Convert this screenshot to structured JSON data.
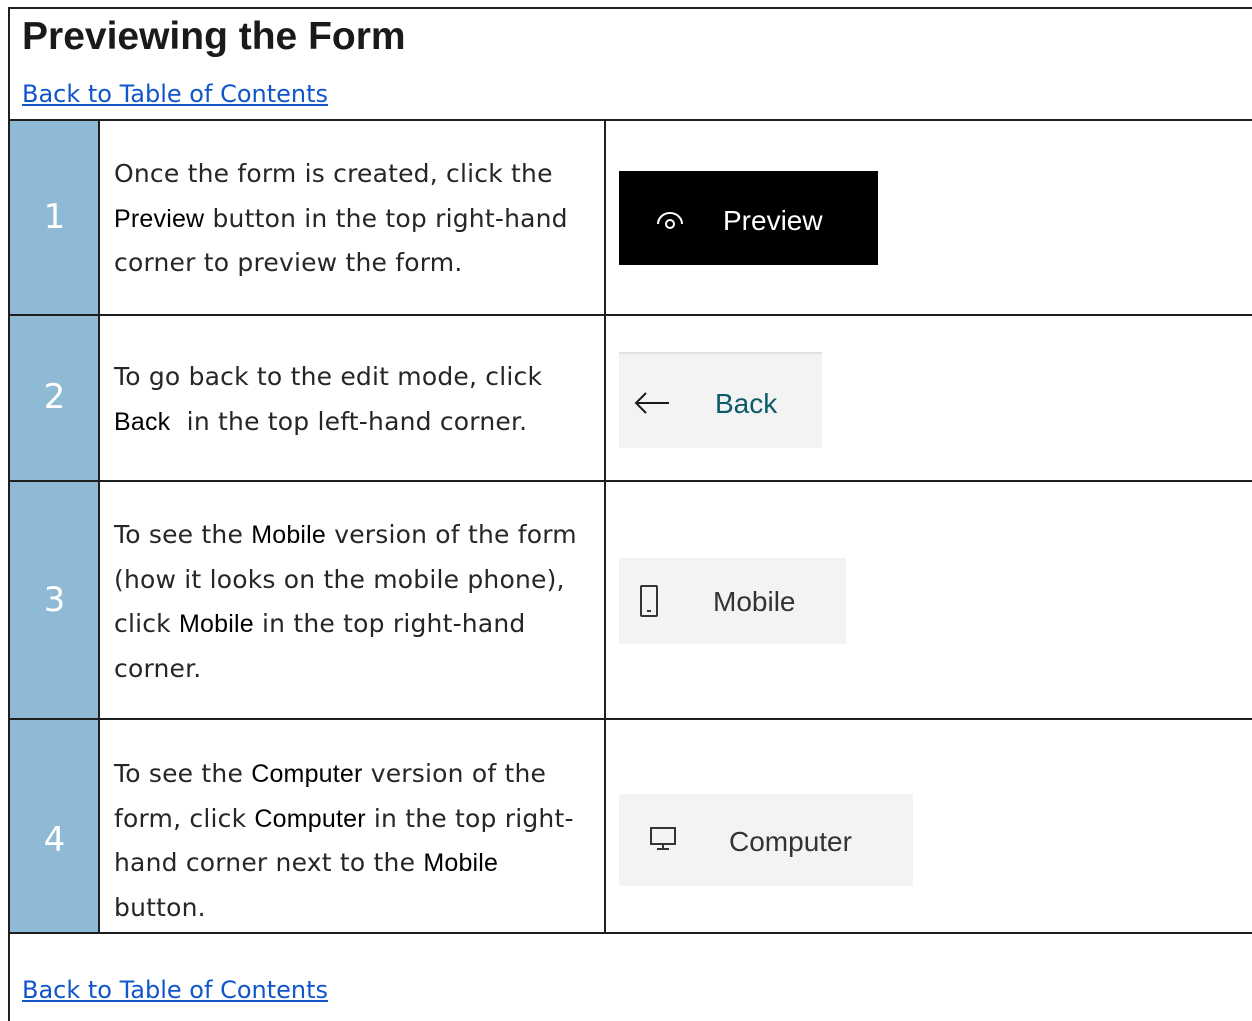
{
  "header": {
    "title": "Previewing the Form",
    "toc_link_top": "Back to Table of Contents"
  },
  "steps": [
    {
      "number": "1",
      "parts": [
        "Once the form is created, click the ",
        "Preview",
        " button in the top right-hand corner to preview the form."
      ],
      "screenshot": {
        "label": "Preview",
        "icon": "eye-icon"
      }
    },
    {
      "number": "2",
      "parts": [
        "To go back to the edit mode, click ",
        "Back",
        "  in the top left-hand corner."
      ],
      "screenshot": {
        "label": "Back",
        "icon": "arrow-left-icon"
      }
    },
    {
      "number": "3",
      "parts": [
        "To see the ",
        "Mobile",
        " version of the form (how it looks on the mobile phone), click ",
        "Mobile",
        " in the top right-hand corner."
      ],
      "screenshot": {
        "label": "Mobile",
        "icon": "phone-icon"
      }
    },
    {
      "number": "4",
      "parts": [
        "To see the ",
        "Computer",
        " version of the form, click ",
        "Computer",
        " in the top right-hand corner next to the ",
        "Mobile",
        " button."
      ],
      "screenshot": {
        "label": "Computer",
        "icon": "monitor-icon"
      }
    }
  ],
  "footer": {
    "toc_link_bottom": "Back to Table of Contents"
  },
  "colors": {
    "number_column": "#8fbad6",
    "link": "#1155cc",
    "rule": "#1f1f1f"
  }
}
